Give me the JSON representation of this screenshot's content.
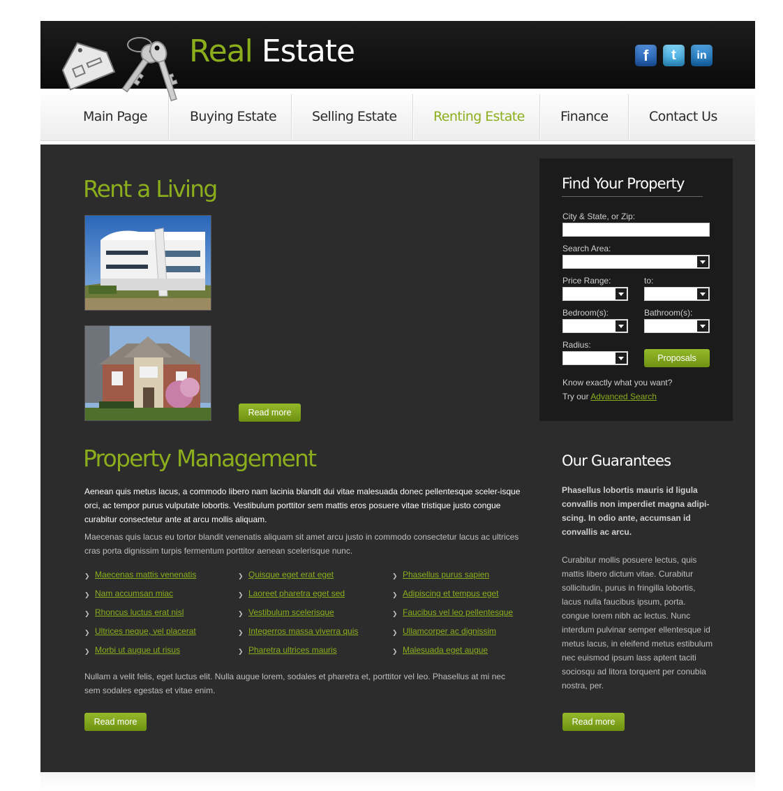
{
  "header": {
    "logo_word1": "Real",
    "logo_word2": "Estate",
    "social": [
      {
        "name": "facebook",
        "glyph": "f"
      },
      {
        "name": "twitter",
        "glyph": "t"
      },
      {
        "name": "linkedin",
        "glyph": "in"
      }
    ]
  },
  "nav": {
    "items": [
      "Main Page",
      "Buying Estate",
      "Selling Estate",
      "Renting Estate",
      "Finance",
      "Contact Us"
    ],
    "active": "Renting Estate"
  },
  "rent": {
    "title": "Rent a Living",
    "read_more": "Read more"
  },
  "management": {
    "title": "Property Management",
    "para1": "Aenean quis metus lacus, a commodo libero nam lacinia blandit dui vitae malesuada donec pellentesque sceler-isque orci, ac tempor purus vulputate lobortis. Vestibulum porttitor sem mattis eros posuere vitae tristique justo congue curabitur consectetur ante at arcu mollis aliquam.",
    "para2": "Maecenas quis lacus eu tortor blandit venenatis aliquam sit amet arcu justo in commodo consectetur lacus ac ultrices cras porta dignissim turpis fermentum porttitor aenean scelerisque nunc.",
    "links": [
      [
        "Maecenas mattis venenatis",
        "Nam accumsan miac",
        "Rhoncus luctus erat nisl",
        "Ultrices neque, vel placerat",
        "Morbi ut augue ut risus"
      ],
      [
        "Quisque eget erat eget",
        "Laoreet pharetra eget sed",
        "Vestibulum scelerisque",
        "Integerros massa viverra quis",
        "Pharetra ultrices mauris "
      ],
      [
        "Phasellus purus sapien",
        "Adipiscing et tempus eget",
        "Faucibus vel leo pellentesque",
        "Ullamcorper ac dignissim",
        "Malesuada eget augue"
      ]
    ],
    "para3": "Nullam a velit felis, eget luctus elit. Nulla augue lorem, sodales et pharetra et, porttitor vel leo. Phasellus at mi nec sem sodales egestas et vitae enim.",
    "read_more": "Read more"
  },
  "find": {
    "title": "Find Your Property",
    "city_label": "City & State, or Zip:",
    "city_value": "",
    "area_label": "Search Area:",
    "price_label": "Price Range:",
    "to_label": "to:",
    "bed_label": "Bedroom(s):",
    "bath_label": "Bathroom(s):",
    "radius_label": "Radius:",
    "submit": "Proposals",
    "note1": "Know exactly what you want?",
    "note2_prefix": "Try our",
    "note2_link": "Advanced Search"
  },
  "guarantees": {
    "title": "Our Guarantees",
    "bold": "Phasellus lobortis mauris id ligula convallis non imperdiet magna adipi-scing. In odio ante, accumsan id convallis ac arcu.",
    "text": "Curabitur mollis posuere lectus, quis mattis libero dictum vitae. Curabitur sollicitudin, purus in fringilla lobortis, lacus nulla faucibus ipsum, porta.  congue lorem nibh ac lectus. Nunc interdum pulvinar semper ellentesque id metus lacus, in eleifend metus estibulum nec euismod ipsum lass aptent taciti sociosqu ad litora torquent per conubia nostra, per.",
    "read_more": "Read more"
  },
  "colors": {
    "accent": "#8cae1c",
    "content_bg": "#2c2c2c",
    "box_bg": "#1b1b1b"
  }
}
